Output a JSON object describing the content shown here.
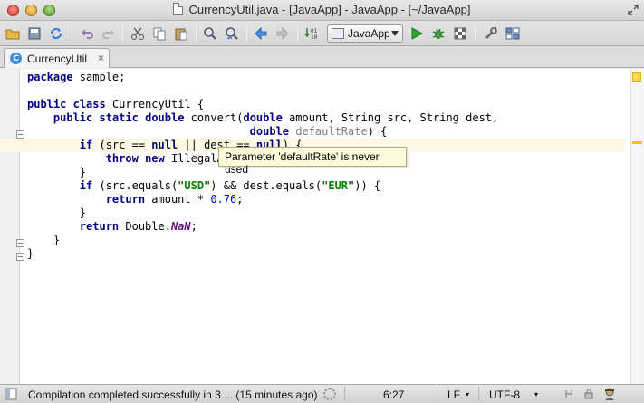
{
  "window": {
    "title": "CurrencyUtil.java - [JavaApp] - JavaApp - [~/JavaApp]"
  },
  "toolbar": {
    "buttons": [
      "open-folder-icon",
      "save-all-icon",
      "synchronize-icon",
      "undo-icon",
      "redo-icon",
      "cut-icon",
      "copy-icon",
      "paste-icon",
      "find-icon",
      "replace-icon",
      "back-icon",
      "forward-icon",
      "make-project-icon",
      "run-icon",
      "debug-icon",
      "coverage-icon",
      "settings-icon",
      "project-structure-icon"
    ],
    "run_config": {
      "label": "JavaApp"
    }
  },
  "tabs": [
    {
      "label": "CurrencyUtil",
      "close": "×",
      "icon": "class-icon",
      "icon_letter": "C"
    }
  ],
  "editor": {
    "lines": [
      [
        {
          "t": "package",
          "c": "kw"
        },
        {
          "t": " sample;"
        }
      ],
      [],
      [
        {
          "t": "public",
          "c": "kw"
        },
        {
          "t": " "
        },
        {
          "t": "class",
          "c": "kw"
        },
        {
          "t": " CurrencyUtil {"
        }
      ],
      [
        {
          "t": "    "
        },
        {
          "t": "public",
          "c": "kw"
        },
        {
          "t": " "
        },
        {
          "t": "static",
          "c": "kw"
        },
        {
          "t": " "
        },
        {
          "t": "double",
          "c": "kw"
        },
        {
          "t": " convert("
        },
        {
          "t": "double",
          "c": "kw"
        },
        {
          "t": " amount, String src, String dest,"
        }
      ],
      [
        {
          "t": "                                  "
        },
        {
          "t": "double",
          "c": "kw"
        },
        {
          "t": " "
        },
        {
          "t": "defaultRate",
          "c": "unused"
        },
        {
          "t": ") {"
        }
      ],
      [
        {
          "t": "        "
        },
        {
          "t": "if",
          "c": "kw"
        },
        {
          "t": " (src == "
        },
        {
          "t": "null",
          "c": "kw"
        },
        {
          "t": " || dest == "
        },
        {
          "t": "null",
          "c": "kw"
        },
        {
          "t": ") {"
        }
      ],
      [
        {
          "t": "            "
        },
        {
          "t": "throw",
          "c": "kw"
        },
        {
          "t": " "
        },
        {
          "t": "new",
          "c": "kw"
        },
        {
          "t": " IllegalA"
        }
      ],
      [
        {
          "t": "        }"
        }
      ],
      [
        {
          "t": "        "
        },
        {
          "t": "if",
          "c": "kw"
        },
        {
          "t": " (src.equals("
        },
        {
          "t": "\"USD\"",
          "c": "str"
        },
        {
          "t": ") && dest.equals("
        },
        {
          "t": "\"EUR\"",
          "c": "str"
        },
        {
          "t": ")) {"
        }
      ],
      [
        {
          "t": "            "
        },
        {
          "t": "return",
          "c": "kw"
        },
        {
          "t": " amount * "
        },
        {
          "t": "0.76",
          "c": "num"
        },
        {
          "t": ";"
        }
      ],
      [
        {
          "t": "        }"
        }
      ],
      [
        {
          "t": "        "
        },
        {
          "t": "return",
          "c": "kw"
        },
        {
          "t": " Double."
        },
        {
          "t": "NaN",
          "c": "ital"
        },
        {
          "t": ";"
        }
      ],
      [
        {
          "t": "    }"
        }
      ],
      [
        {
          "t": "}"
        }
      ]
    ],
    "tooltip": "Parameter 'defaultRate' is never used"
  },
  "status": {
    "message": "Compilation completed successfully in 3 ... (15 minutes ago)",
    "position": "6:27",
    "line_separator": "LF",
    "encoding": "UTF-8"
  }
}
